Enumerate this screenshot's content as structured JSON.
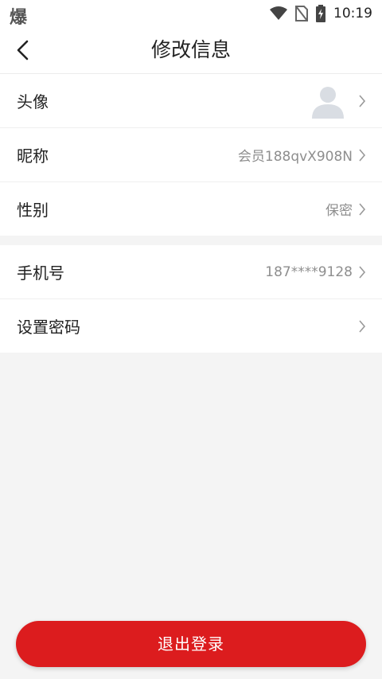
{
  "status_bar": {
    "app_icon_char": "爆",
    "time": "10:19",
    "icons": [
      "wifi-icon",
      "no-sim-icon",
      "battery-charging-icon"
    ]
  },
  "header": {
    "title": "修改信息",
    "back_icon": "chevron-left-icon"
  },
  "profile": {
    "avatar_label": "头像",
    "avatar_icon": "default-avatar-icon",
    "nickname_label": "昵称",
    "nickname_value": "会员188qvX908N",
    "gender_label": "性别",
    "gender_value": "保密"
  },
  "account": {
    "phone_label": "手机号",
    "phone_value": "187****9128",
    "password_label": "设置密码"
  },
  "actions": {
    "logout_label": "退出登录"
  },
  "colors": {
    "accent": "#dc1c1e",
    "background": "#f4f4f4",
    "value_text": "#8e8e8e"
  }
}
